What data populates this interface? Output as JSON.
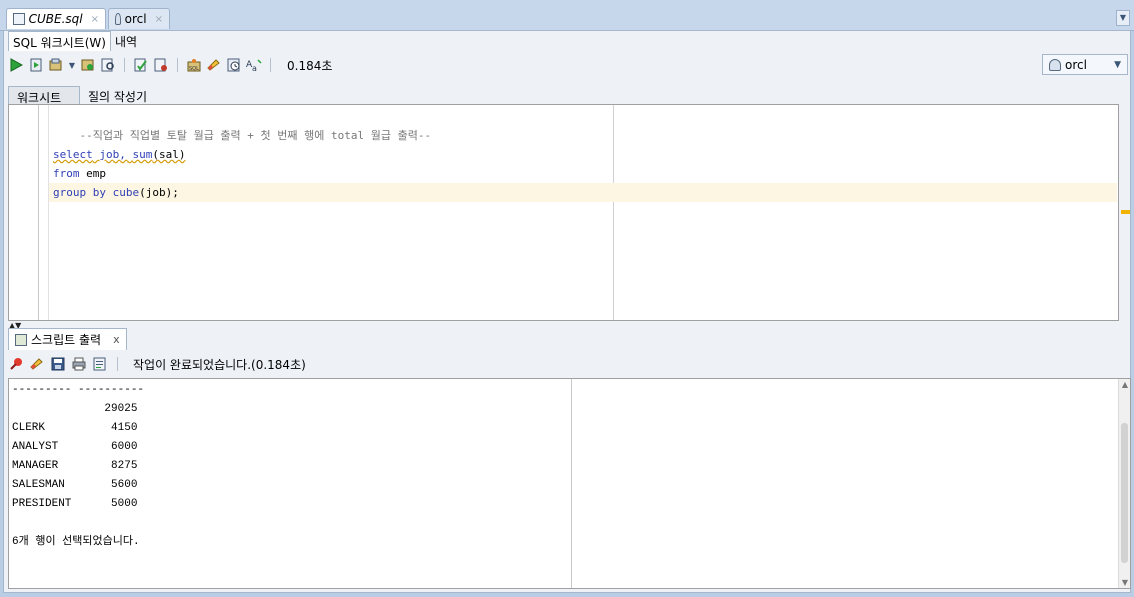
{
  "editor_tabs": [
    {
      "label": "CUBE.sql",
      "close": "×"
    },
    {
      "label": "orcl",
      "close": "×"
    }
  ],
  "subtabs": [
    "SQL 워크시트(W)",
    "내역"
  ],
  "toolbar": {
    "elapsed": "0.184초",
    "connection": "orcl",
    "icons": [
      "run-statement-icon",
      "run-script-icon",
      "commit-icon",
      "rollback-icon",
      "explain-plan-icon",
      "autotrace-icon",
      "sql-tuning-icon",
      "unshared-sql-icon",
      "clear-icon",
      "history-icon",
      "format-icon"
    ]
  },
  "worksheet_tabs": [
    "워크시트",
    "질의 작성기"
  ],
  "code": {
    "line1": "--직업과 직업별 토탈 월급 출력 + 첫 번째 행에 total 월급 출력--",
    "line3_kw1": "select",
    "line3_txt": " job, ",
    "line3_kw2": "sum",
    "line3_txt2": "(sal)",
    "line4_kw": "from",
    "line4_txt": " emp",
    "line5_kw": "group by",
    "line5_kw2": " cube",
    "line5_txt": "(job);"
  },
  "output_panel": {
    "tab_label": "스크립트 출력",
    "tab_close": "x",
    "status": "작업이 완료되었습니다.(0.184초)",
    "text": "--------- ----------\n              29025\nCLERK          4150\nANALYST        6000\nMANAGER        8275\nSALESMAN       5600\nPRESIDENT      5000\n\n6개 행이 선택되었습니다."
  }
}
